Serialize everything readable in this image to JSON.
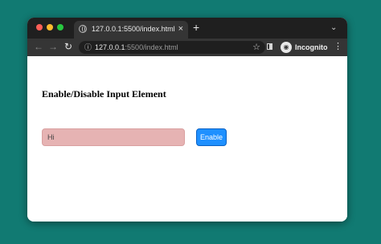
{
  "browser": {
    "tab": {
      "title": "127.0.0.1:5500/index.html",
      "close_icon": "×"
    },
    "new_tab_icon": "+",
    "tab_menu_icon": "⌄",
    "nav": {
      "back_icon": "←",
      "forward_icon": "→",
      "reload_icon": "↻"
    },
    "address": {
      "host": "127.0.0.1",
      "rest": ":5500/index.html"
    },
    "bookmark_icon": "☆",
    "profile": {
      "label": "Incognito",
      "icon": "◉"
    },
    "menu_icon": "⋮"
  },
  "page": {
    "heading": "Enable/Disable Input Element",
    "input": {
      "value": "Hi",
      "disabled": true
    },
    "button_label": "Enable"
  },
  "colors": {
    "desktop": "#117a72",
    "input_disabled_bg": "#e6b3b3",
    "button_bg": "#1e90ff"
  }
}
